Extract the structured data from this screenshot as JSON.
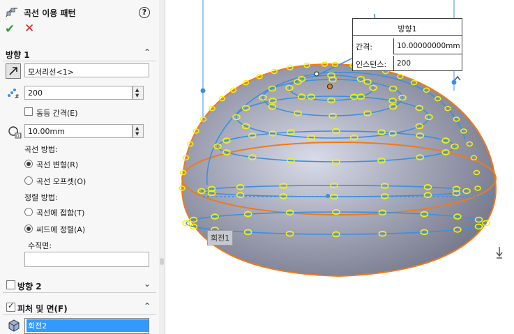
{
  "panel": {
    "title": "곡선 이용 패턴",
    "help_icon": "?",
    "ok_icon": "✔",
    "cancel_icon": "✕",
    "direction1": {
      "header": "방향 1",
      "edge_value": "모서리선<1>",
      "instances": "200",
      "equal_spacing_label": "동등 간격(E)",
      "equal_spacing_checked": false,
      "spacing": "10.00mm",
      "curve_method_label": "곡선 방법:",
      "curve_method_options": [
        "곡선 변형(R)",
        "곡선 오프셋(O)"
      ],
      "curve_method_selected": "곡선 변형(R)",
      "align_method_label": "정렬 방법:",
      "align_method_options": [
        "곡선에 접함(T)",
        "씨드에 정렬(A)"
      ],
      "align_method_selected": "씨드에 정렬(A)",
      "normal_face_label": "수직면:",
      "normal_face_value": ""
    },
    "direction2": {
      "header": "방향 2",
      "checked": false
    },
    "features": {
      "header": "피처 및 면(F)",
      "checked": true,
      "selected_item": "회전2"
    }
  },
  "viewport": {
    "callout": {
      "title": "방향1",
      "spacing_label": "간격:",
      "spacing_value": "10.00000000mm",
      "instances_label": "인스턴스:",
      "instances_value": "200"
    },
    "body_tag": "회전1"
  },
  "colors": {
    "accent_blue": "#3d8fe0",
    "orange_edge": "#f07a1a",
    "preview_yellow": "#f4f400",
    "selection_blue": "#3399ff",
    "ok_green": "#2f9a2f",
    "cancel_red": "#d32222"
  }
}
